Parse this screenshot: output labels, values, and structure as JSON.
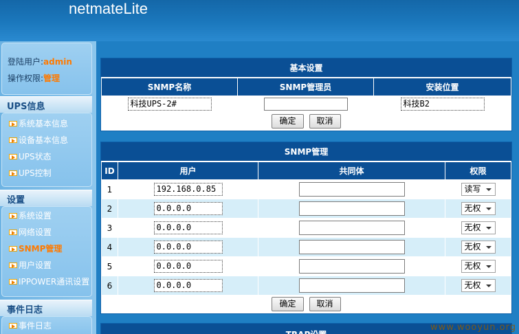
{
  "app": {
    "title": "netmateLite"
  },
  "login": {
    "user_label": "登陆用户:",
    "user_value": "admin",
    "perm_label": "操作权限:",
    "perm_value": "管理"
  },
  "sidebar": {
    "sections": [
      {
        "title": "UPS信息",
        "items": [
          "系统基本信息",
          "设备基本信息",
          "UPS状态",
          "UPS控制"
        ]
      },
      {
        "title": "设置",
        "items": [
          "系统设置",
          "网络设置",
          "SNMP管理",
          "用户设置",
          "IPPOWER通讯设置"
        ],
        "active": "SNMP管理"
      },
      {
        "title": "事件日志",
        "items": [
          "事件日志"
        ]
      }
    ]
  },
  "basic": {
    "title": "基本设置",
    "headers": [
      "SNMP名称",
      "SNMP管理员",
      "安装位置"
    ],
    "values": [
      "科技UPS-2#",
      "",
      "科技B2"
    ],
    "ok": "确定",
    "cancel": "取消"
  },
  "snmp": {
    "title": "SNMP管理",
    "headers": [
      "ID",
      "用户",
      "共同体",
      "权限"
    ],
    "rows": [
      {
        "id": "1",
        "user": "192.168.0.85",
        "community": "",
        "perm": "读写"
      },
      {
        "id": "2",
        "user": "0.0.0.0",
        "community": "",
        "perm": "无权"
      },
      {
        "id": "3",
        "user": "0.0.0.0",
        "community": "",
        "perm": "无权"
      },
      {
        "id": "4",
        "user": "0.0.0.0",
        "community": "",
        "perm": "无权"
      },
      {
        "id": "5",
        "user": "0.0.0.0",
        "community": "",
        "perm": "无权"
      },
      {
        "id": "6",
        "user": "0.0.0.0",
        "community": "",
        "perm": "无权"
      }
    ],
    "ok": "确定",
    "cancel": "取消"
  },
  "trap": {
    "title": "TRAP设置"
  },
  "watermark": "www.wooyun.org",
  "colors": {
    "header_bg": "#0a4f95",
    "accent": "#ff7a00",
    "alt_row": "#d6eef9"
  }
}
